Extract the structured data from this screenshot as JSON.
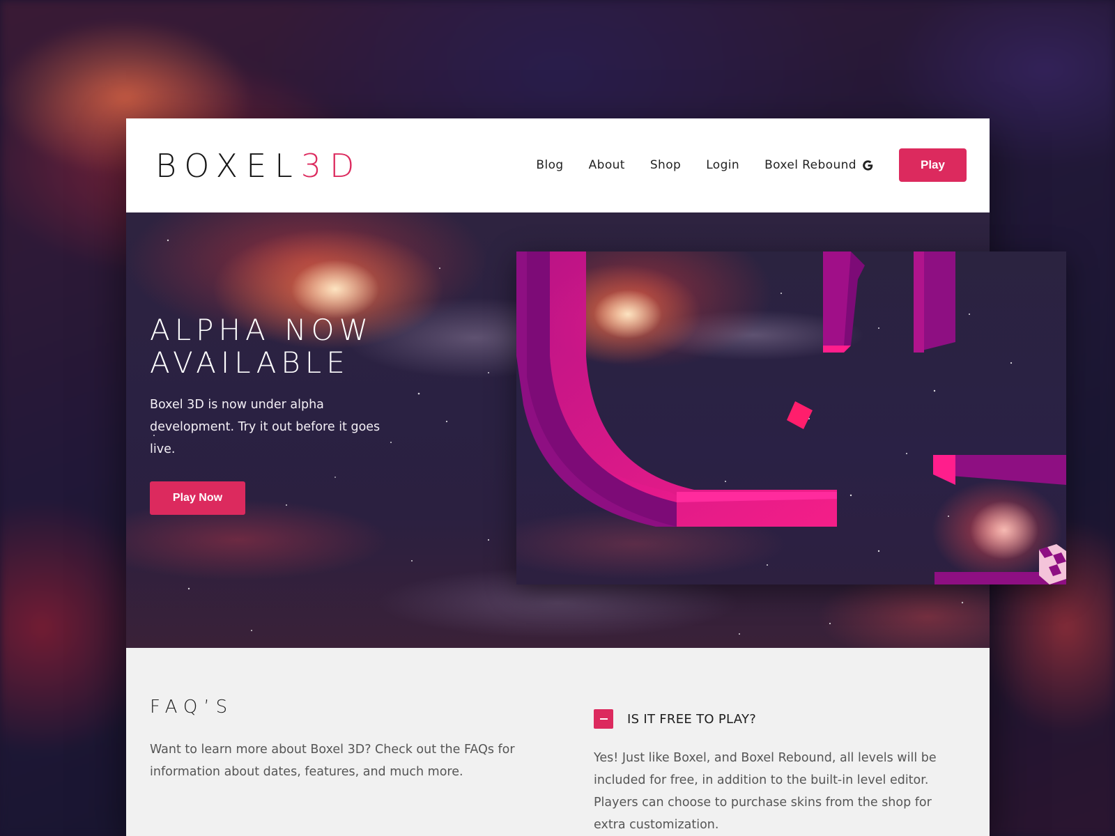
{
  "brand": {
    "name_main": "BOXEL",
    "name_accent": "3D",
    "accent_color": "#dc2a5e"
  },
  "nav": {
    "items": [
      {
        "label": "Blog"
      },
      {
        "label": "About"
      },
      {
        "label": "Shop"
      },
      {
        "label": "Login"
      },
      {
        "label": "Boxel Rebound",
        "icon": "google-icon"
      }
    ],
    "play_label": "Play"
  },
  "hero": {
    "title": "ALPHA NOW AVAILABLE",
    "text": "Boxel 3D is now under alpha development. Try it out before it goes live.",
    "cta_label": "Play Now"
  },
  "faq": {
    "title": "FAQ’S",
    "intro": "Want to learn more about Boxel 3D? Check out the FAQs for information about dates, features, and much more.",
    "items": [
      {
        "question": "IS IT FREE TO PLAY?",
        "expanded": true,
        "toggle_icon": "minus-icon",
        "answer": "Yes! Just like Boxel, and Boxel Rebound, all levels will be included for free, in addition to the built-in level editor. Players can choose to purchase skins from the shop for extra customization."
      }
    ]
  }
}
